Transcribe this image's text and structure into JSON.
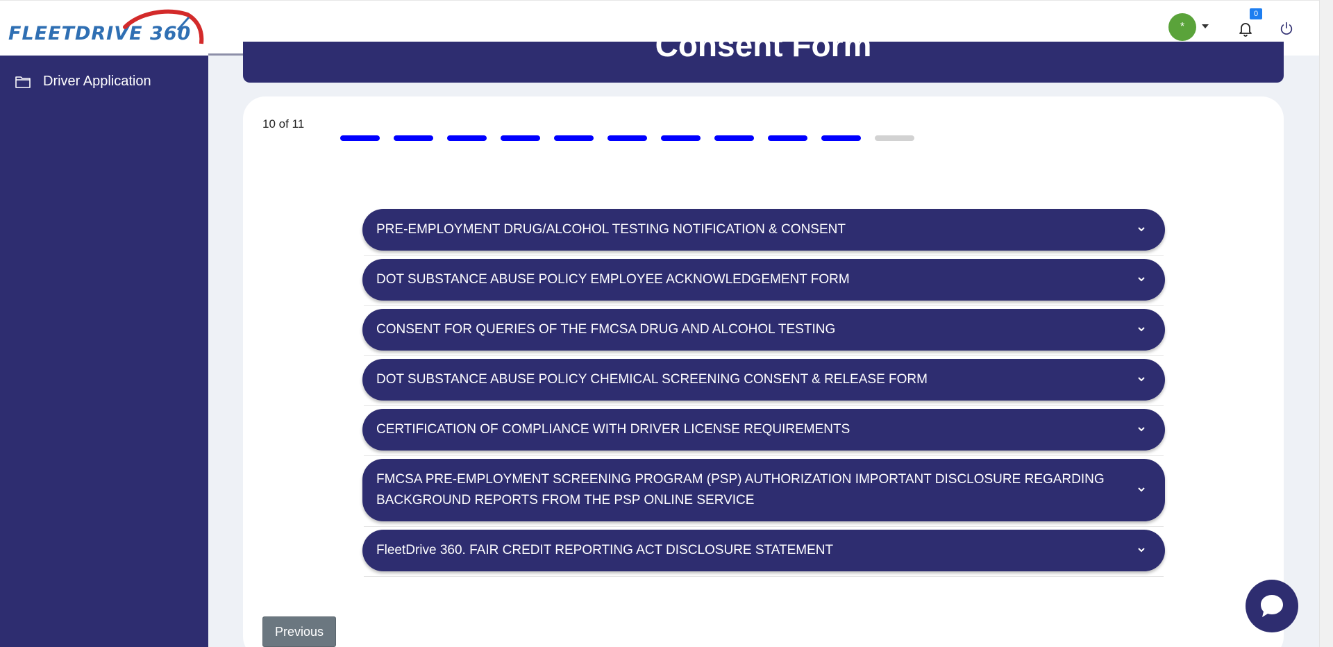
{
  "header": {
    "logo_text": "FLEETDRIVE 360",
    "avatar_initial": "*",
    "notification_count": "0"
  },
  "sidebar": {
    "items": [
      {
        "label": "Driver Application",
        "icon": "folder-icon"
      }
    ]
  },
  "page": {
    "title": "Consent Form"
  },
  "wizard": {
    "step_text": "10 of 11",
    "current_step": 10,
    "total_steps": 11
  },
  "sections": [
    {
      "label": "PRE-EMPLOYMENT DRUG/ALCOHOL TESTING NOTIFICATION & CONSENT"
    },
    {
      "label": "DOT SUBSTANCE ABUSE POLICY EMPLOYEE ACKNOWLEDGEMENT FORM"
    },
    {
      "label": "CONSENT FOR QUERIES OF THE FMCSA DRUG AND ALCOHOL TESTING"
    },
    {
      "label": "DOT SUBSTANCE ABUSE POLICY CHEMICAL SCREENING CONSENT & RELEASE FORM"
    },
    {
      "label": "CERTIFICATION OF COMPLIANCE WITH DRIVER LICENSE REQUIREMENTS"
    },
    {
      "label": "FMCSA PRE-EMPLOYMENT SCREENING PROGRAM (PSP) AUTHORIZATION IMPORTANT DISCLOSURE REGARDING BACKGROUND REPORTS FROM THE PSP ONLINE SERVICE"
    },
    {
      "label": "FleetDrive 360. FAIR CREDIT REPORTING ACT DISCLOSURE STATEMENT"
    }
  ],
  "buttons": {
    "previous": "Previous"
  },
  "colors": {
    "primary": "#2e2d70",
    "progress_active": "#0000ff",
    "progress_inactive": "#d2d2d2",
    "avatar": "#5aa33a"
  }
}
